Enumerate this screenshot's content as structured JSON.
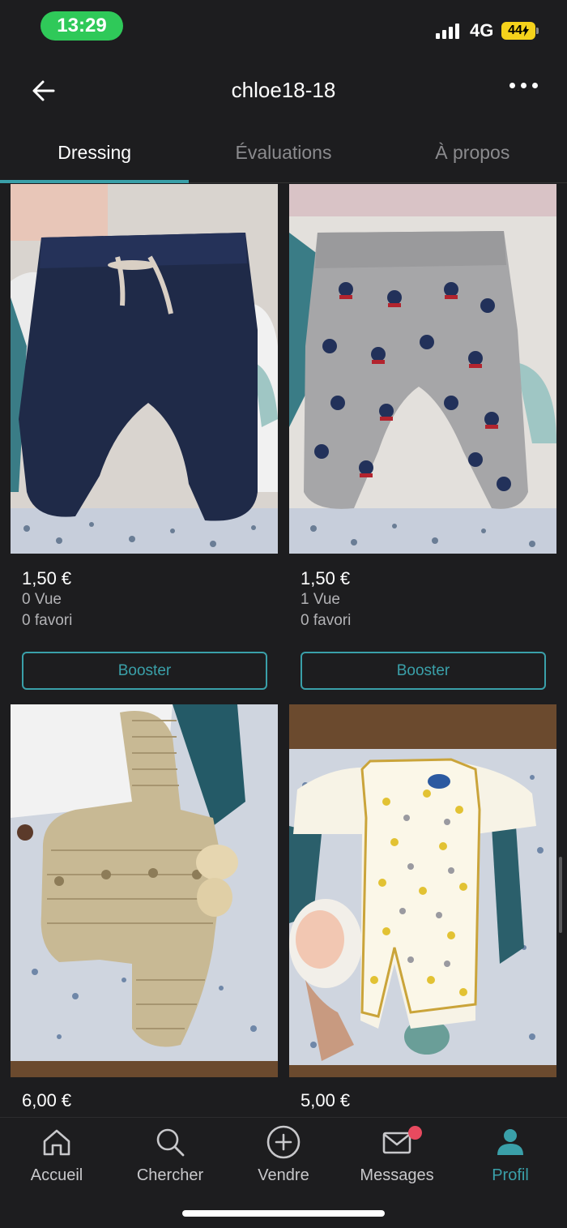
{
  "status_bar": {
    "time": "13:29",
    "network": "4G",
    "battery": "44"
  },
  "header": {
    "title": "chloe18-18"
  },
  "tabs": [
    {
      "label": "Dressing"
    },
    {
      "label": "Évaluations"
    },
    {
      "label": "À propos"
    }
  ],
  "items": [
    {
      "price": "1,50 €",
      "views": "0 Vue",
      "favorites": "0 favori",
      "boost_label": "Booster"
    },
    {
      "price": "1,50 €",
      "views": "1 Vue",
      "favorites": "0 favori",
      "boost_label": "Booster"
    },
    {
      "price": "6,00 €"
    },
    {
      "price": "5,00 €"
    }
  ],
  "bottom_nav": [
    {
      "label": "Accueil",
      "icon": "home-icon"
    },
    {
      "label": "Chercher",
      "icon": "search-icon"
    },
    {
      "label": "Vendre",
      "icon": "plus-circle-icon"
    },
    {
      "label": "Messages",
      "icon": "mail-icon"
    },
    {
      "label": "Profil",
      "icon": "profile-icon"
    }
  ],
  "colors": {
    "accent": "#3aa0a9",
    "background": "#1d1d1f",
    "badge": "#e84a5f",
    "time_pill": "#2fc959"
  }
}
